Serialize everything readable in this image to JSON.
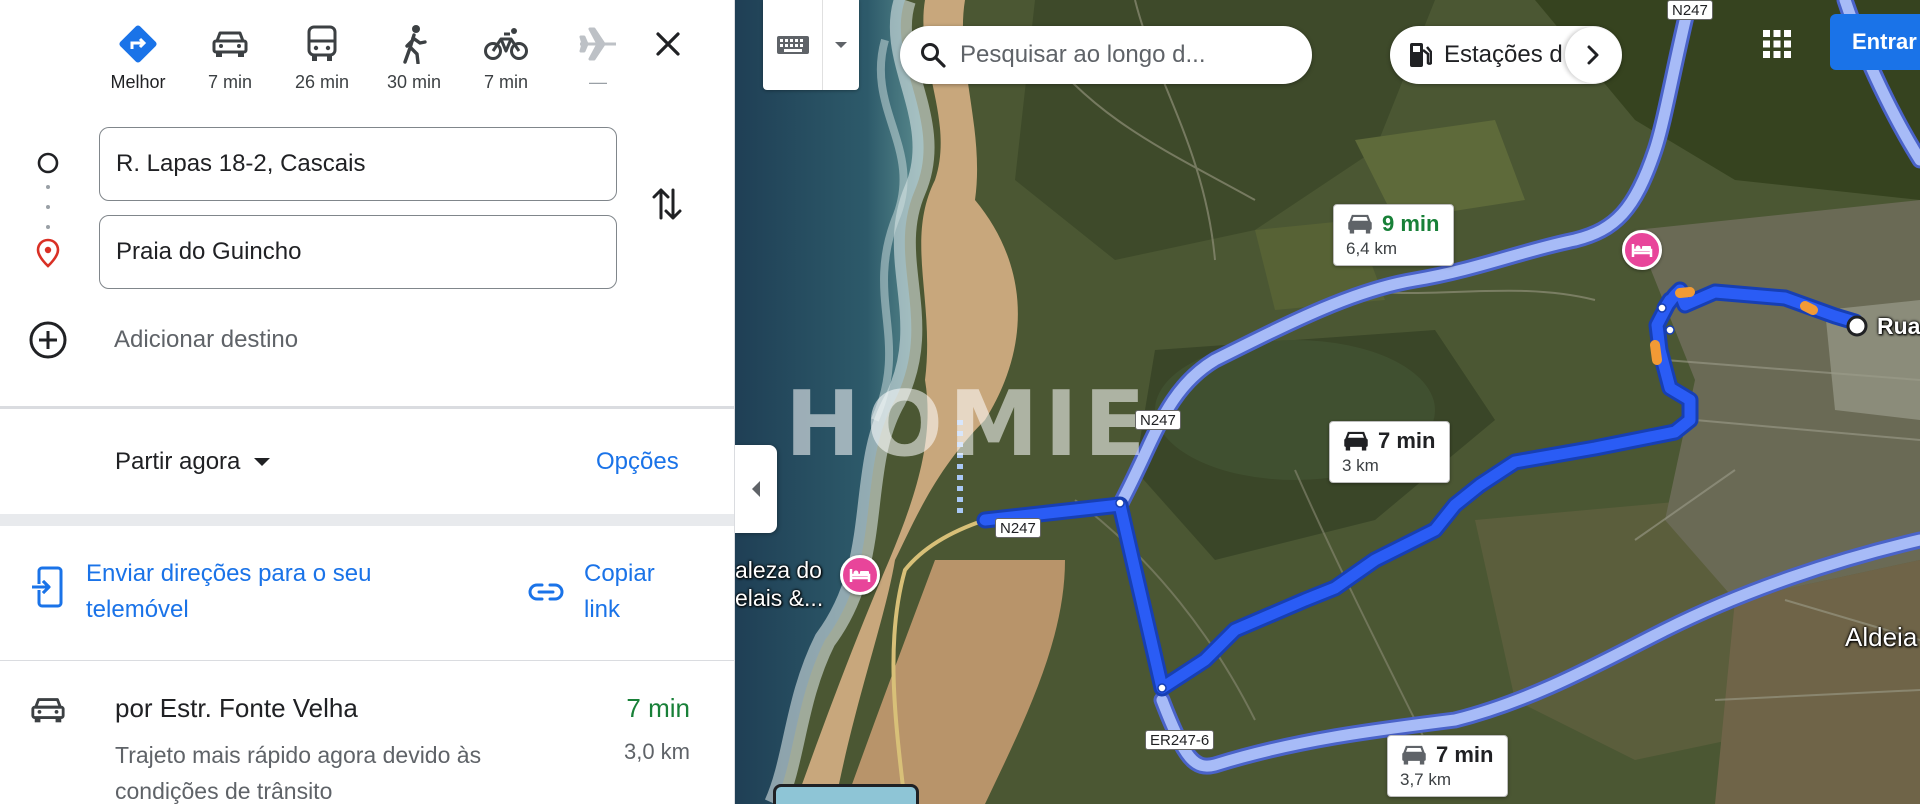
{
  "panel": {
    "modes": [
      {
        "label": "Melhor",
        "icon": "best-route-icon",
        "active": true
      },
      {
        "label": "7 min",
        "icon": "car-icon"
      },
      {
        "label": "26 min",
        "icon": "bus-icon"
      },
      {
        "label": "30 min",
        "icon": "walk-icon"
      },
      {
        "label": "7 min",
        "icon": "bicycle-icon"
      },
      {
        "label": "—",
        "icon": "airplane-icon",
        "disabled": true
      }
    ],
    "origin": "R. Lapas 18-2, Cascais",
    "destination": "Praia do Guincho",
    "add_destination": "Adicionar destino",
    "leave_now": "Partir agora",
    "options": "Opções",
    "send_directions": "Enviar direções para o seu telemóvel",
    "copy_link": "Copiar link",
    "route": {
      "title": "por Estr. Fonte Velha",
      "description": "Trajeto mais rápido agora devido às condições de trânsito",
      "time": "7 min",
      "distance": "3,0 km"
    }
  },
  "map": {
    "search_placeholder": "Pesquisar ao longo d...",
    "chip_label": "Estações d",
    "sign_in": "Entrar",
    "route_labels": [
      {
        "time": "9 min",
        "distance": "6,4 km",
        "highlight": true
      },
      {
        "time": "7 min",
        "distance": "3 km"
      },
      {
        "time": "7 min",
        "distance": "3,7 km"
      }
    ],
    "road_labels": [
      "N247",
      "N247",
      "N247",
      "ER247-6"
    ],
    "places": {
      "hotel_left": "aleza do\nelais &...",
      "origin_label": "Rua",
      "town": "Aldeia"
    },
    "watermark": "HOMIE"
  }
}
